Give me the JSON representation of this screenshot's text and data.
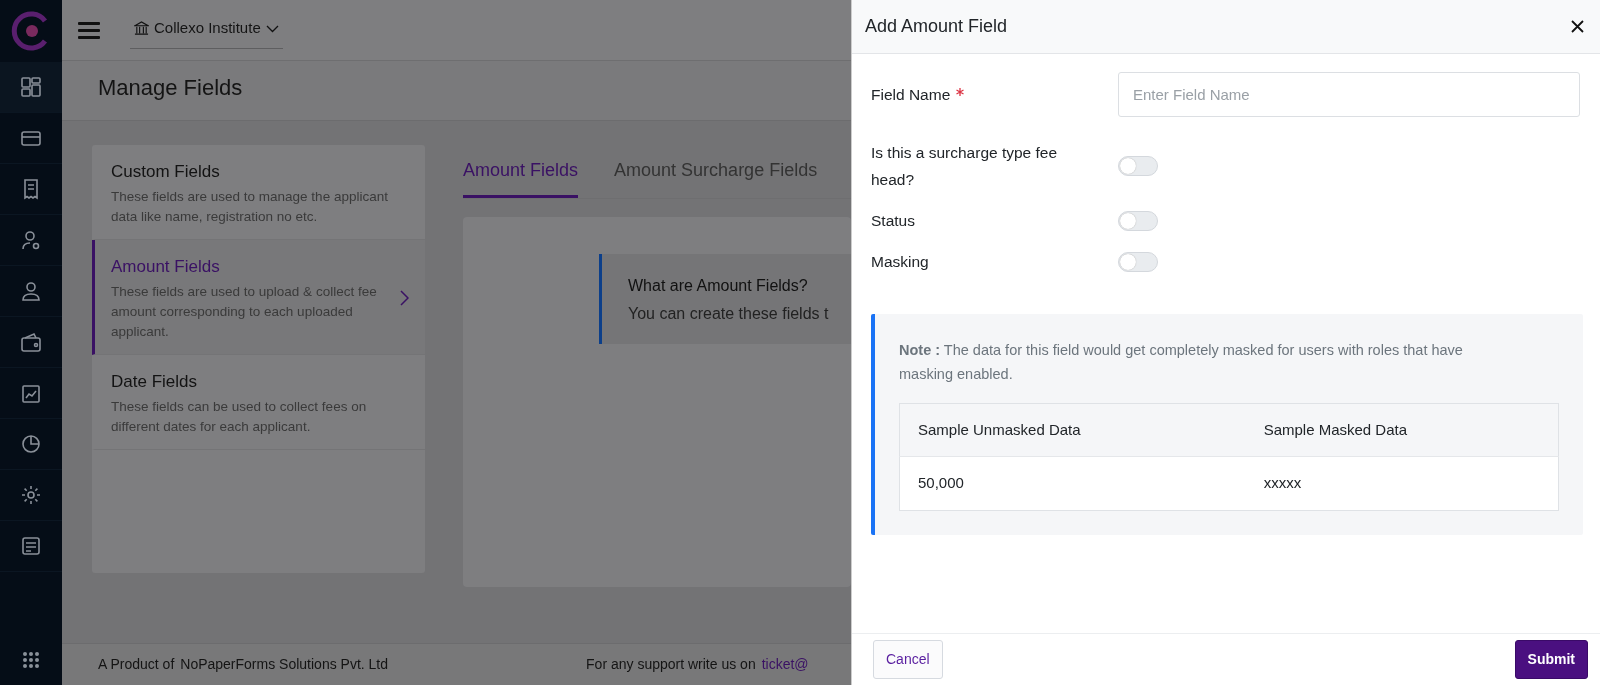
{
  "header": {
    "institute": "Collexo Institute"
  },
  "page_title": "Manage Fields",
  "field_types": [
    {
      "title": "Custom Fields",
      "description": "These fields are used to manage the applicant data like name, registration no etc.",
      "selected": false
    },
    {
      "title": "Amount Fields",
      "description": "These fields are used to upload & collect fee amount corresponding to each uploaded applicant.",
      "selected": true
    },
    {
      "title": "Date Fields",
      "description": "These fields can be used to collect fees on different dates for each applicant.",
      "selected": false
    }
  ],
  "tabs": [
    {
      "label": "Amount Fields",
      "selected": true
    },
    {
      "label": "Amount Surcharge Fields",
      "selected": false
    }
  ],
  "info_box": {
    "title": "What are Amount Fields?",
    "text": "You can create these fields t"
  },
  "footer": {
    "product_label": "A Product of",
    "company": "NoPaperForms Solutions Pvt. Ltd",
    "support_text": "For any support write us on",
    "support_email": "ticket@"
  },
  "drawer": {
    "title": "Add Amount Field",
    "fields": [
      {
        "kind": "text",
        "label": "Field Name",
        "required": true,
        "placeholder": "Enter Field Name"
      },
      {
        "kind": "switch",
        "label": "Is this a surcharge type fee head?",
        "required": false,
        "on": false
      },
      {
        "kind": "switch",
        "label": "Status",
        "required": false,
        "on": false
      },
      {
        "kind": "switch",
        "label": "Masking",
        "required": false,
        "on": false
      }
    ],
    "note": "**Note :** The data for this field would get completely masked for users with roles that have masking enabled.",
    "table": {
      "columns": [
        "Sample Unmasked Data",
        "Sample Masked Data"
      ],
      "rows": [
        [
          "50,000",
          "xxxxx"
        ]
      ]
    },
    "buttons": {
      "cancel": "Cancel",
      "submit": "Submit"
    }
  }
}
